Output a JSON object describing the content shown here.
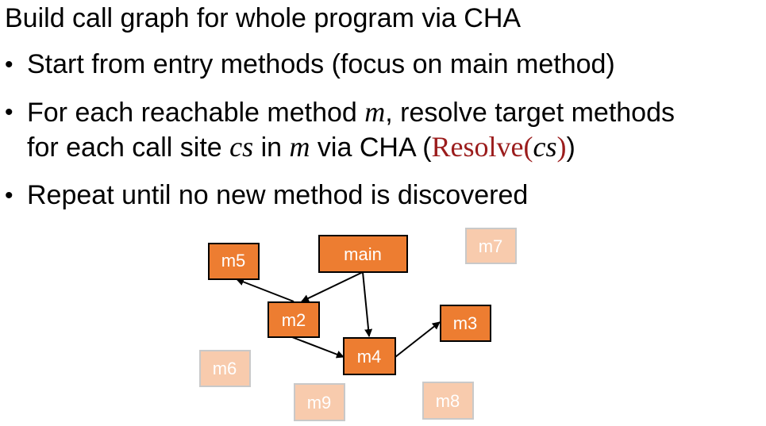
{
  "slide": {
    "title": "Build call graph for whole program via CHA",
    "bullets": {
      "b1": {
        "text": "Start from entry methods (focus on main method)"
      },
      "b2": {
        "part1": "For each reachable method ",
        "var_m": "m",
        "part2": ", resolve target methods",
        "part3": "for each call site ",
        "var_cs": "cs",
        "part4": " in ",
        "var_m2": "m",
        "part5": " via CHA (",
        "resolve_word": "Resolve",
        "resolve_open": "(",
        "resolve_arg": "cs",
        "resolve_close": ")",
        "part6": ")"
      },
      "b3": {
        "text": "Repeat until no new method is discovered"
      }
    },
    "bullet_glyph": "•"
  },
  "graph": {
    "colors": {
      "reachable_fill": "#ed7d31",
      "unreachable_fill": "#f8cbad",
      "edge": "#000000",
      "resolve_text": "#9b1c1c"
    },
    "nodes": {
      "main": {
        "label": "main",
        "reachable": true
      },
      "m5": {
        "label": "m5",
        "reachable": true
      },
      "m2": {
        "label": "m2",
        "reachable": true
      },
      "m3": {
        "label": "m3",
        "reachable": true
      },
      "m4": {
        "label": "m4",
        "reachable": true
      },
      "m7": {
        "label": "m7",
        "reachable": false
      },
      "m6": {
        "label": "m6",
        "reachable": false
      },
      "m9": {
        "label": "m9",
        "reachable": false
      },
      "m8": {
        "label": "m8",
        "reachable": false
      }
    },
    "edges": [
      {
        "from": "main",
        "to": "m2"
      },
      {
        "from": "main",
        "to": "m4"
      },
      {
        "from": "m2",
        "to": "m5"
      },
      {
        "from": "m2",
        "to": "m4"
      },
      {
        "from": "m4",
        "to": "m3"
      }
    ]
  }
}
